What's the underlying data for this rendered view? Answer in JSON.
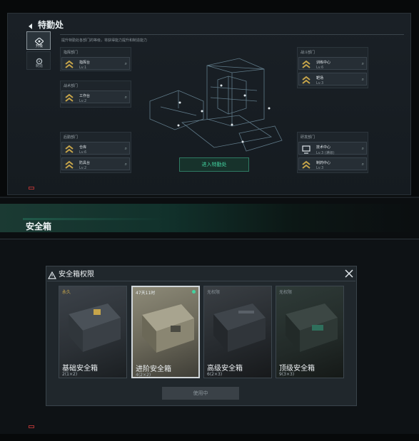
{
  "hq": {
    "title": "特勤处",
    "subtitle": "提升特勤处各部门的等级，将获得能力提升和制造能力",
    "sidebar": [
      {
        "label": "升级",
        "active": true
      },
      {
        "label": "制造",
        "active": false
      }
    ],
    "depts": {
      "left_top": {
        "label": "指挥部门",
        "items": [
          {
            "name": "指挥台",
            "lv": "Lv.1"
          }
        ]
      },
      "left_mid": {
        "label": "战术部门",
        "items": [
          {
            "name": "工作台",
            "lv": "Lv.2"
          }
        ]
      },
      "left_bot": {
        "label": "后勤部门",
        "items": [
          {
            "name": "仓库",
            "lv": "Lv.6"
          },
          {
            "name": "防具台",
            "lv": "Lv.2"
          }
        ]
      },
      "right_top": {
        "label": "战斗部门",
        "items": [
          {
            "name": "训练中心",
            "lv": "Lv.6"
          },
          {
            "name": "靶场",
            "lv": "Lv.3"
          }
        ]
      },
      "right_bot": {
        "label": "研发部门",
        "items": [
          {
            "name": "技术中心",
            "lv": "Lv.3 (满级)"
          },
          {
            "name": "制药中心",
            "lv": "Lv.3"
          }
        ]
      }
    },
    "enter_button": "进入特勤处"
  },
  "section_title": "安全箱",
  "modal": {
    "title": "安全箱权限",
    "close_icon": "close-icon",
    "safes": [
      {
        "tag": "永久",
        "name": "基础安全箱",
        "cap": "2(1×2)",
        "selected": false
      },
      {
        "tag": "47天11时",
        "name": "进阶安全箱",
        "cap": "4(2×2)",
        "selected": true
      },
      {
        "tag": "无权限",
        "name": "高级安全箱",
        "cap": "6(2×3)",
        "selected": false
      },
      {
        "tag": "无权限",
        "name": "顶级安全箱",
        "cap": "9(3×3)",
        "selected": false
      }
    ],
    "use_button": "使用中"
  },
  "colors": {
    "accent_green": "#43d3a1",
    "gold": "#c7a54a"
  }
}
